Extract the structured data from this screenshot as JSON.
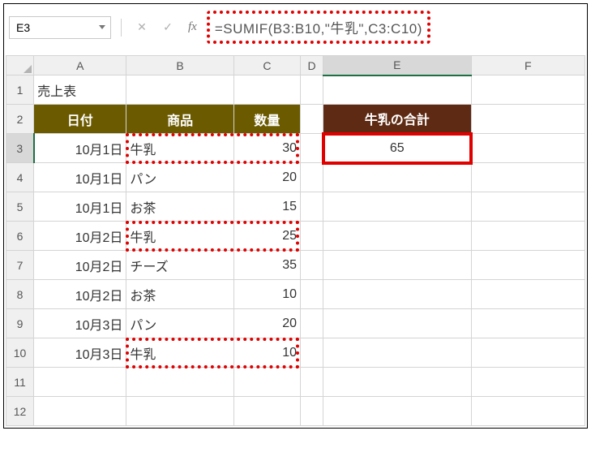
{
  "namebox": {
    "value": "E3"
  },
  "formula": "=SUMIF(B3:B10,\"牛乳\",C3:C10)",
  "columns": [
    "A",
    "B",
    "C",
    "D",
    "E",
    "F"
  ],
  "rows": [
    "1",
    "2",
    "3",
    "4",
    "5",
    "6",
    "7",
    "8",
    "9",
    "10",
    "11",
    "12"
  ],
  "title_cell": "売上表",
  "headers": {
    "A": "日付",
    "B": "商品",
    "C": "数量",
    "E": "牛乳の合計"
  },
  "data_rows": [
    {
      "date": "10月1日",
      "product": "牛乳",
      "qty": "30"
    },
    {
      "date": "10月1日",
      "product": "パン",
      "qty": "20"
    },
    {
      "date": "10月1日",
      "product": "お茶",
      "qty": "15"
    },
    {
      "date": "10月2日",
      "product": "牛乳",
      "qty": "25"
    },
    {
      "date": "10月2日",
      "product": "チーズ",
      "qty": "35"
    },
    {
      "date": "10月2日",
      "product": "お茶",
      "qty": "10"
    },
    {
      "date": "10月3日",
      "product": "パン",
      "qty": "20"
    },
    {
      "date": "10月3日",
      "product": "牛乳",
      "qty": "10"
    }
  ],
  "result_E3": "65",
  "icons": {
    "cancel": "✕",
    "confirm": "✓",
    "fx": "fx"
  }
}
